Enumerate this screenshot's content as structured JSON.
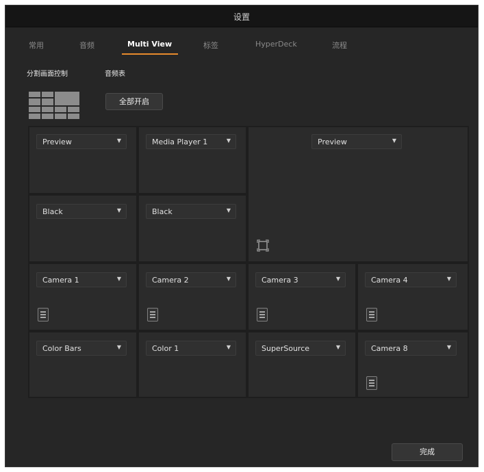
{
  "window": {
    "title": "设置"
  },
  "tabs": [
    {
      "label": "常用"
    },
    {
      "label": "音频"
    },
    {
      "label": "Multi View"
    },
    {
      "label": "标签"
    },
    {
      "label": "HyperDeck"
    },
    {
      "label": "流程"
    }
  ],
  "active_tab": "Multi View",
  "accent_color": "#e88b2c",
  "controls": {
    "layout_label": "分割画面控制",
    "meters_label": "音频表",
    "all_on_button": "全部开启"
  },
  "views": {
    "top_left": "Preview",
    "top_mid": "Media Player 1",
    "big": "Preview",
    "mid_left": "Black",
    "mid_mid": "Black",
    "r3c1": "Camera 1",
    "r3c2": "Camera 2",
    "r3c3": "Camera 3",
    "r3c4": "Camera 4",
    "r4c1": "Color Bars",
    "r4c2": "Color 1",
    "r4c3": "SuperSource",
    "r4c4": "Camera 8"
  },
  "footer": {
    "done_button": "完成"
  },
  "icons": {
    "layout": "quad-layout-icon",
    "expand": "swap-layout-icon",
    "audio_meter": "audio-meter-icon",
    "dropdown": "chevron-down-icon"
  }
}
